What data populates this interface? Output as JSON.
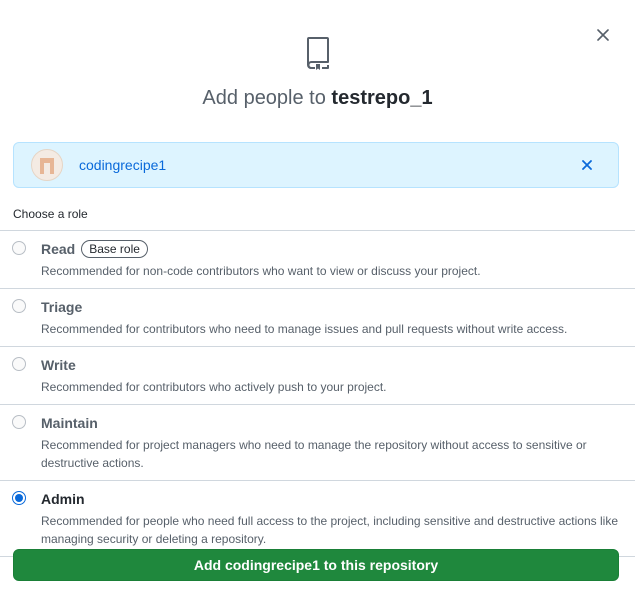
{
  "dialog": {
    "close_icon": "x-icon",
    "repo_icon": "repo-icon",
    "title_prefix": "Add people to",
    "repo_name": "testrepo_1"
  },
  "selected_user": {
    "username": "codingrecipe1",
    "remove_icon": "x-icon",
    "colors": {
      "background": "#ddf4ff",
      "link": "#0969da"
    }
  },
  "role_heading": "Choose a role",
  "roles": [
    {
      "name": "Read",
      "badge": "Base role",
      "description": "Recommended for non-code contributors who want to view or discuss your project.",
      "selected": false
    },
    {
      "name": "Triage",
      "badge": "",
      "description": "Recommended for contributors who need to manage issues and pull requests without write access.",
      "selected": false
    },
    {
      "name": "Write",
      "badge": "",
      "description": "Recommended for contributors who actively push to your project.",
      "selected": false
    },
    {
      "name": "Maintain",
      "badge": "",
      "description": "Recommended for project managers who need to manage the repository without access to sensitive or destructive actions.",
      "selected": false
    },
    {
      "name": "Admin",
      "badge": "",
      "description": "Recommended for people who need full access to the project, including sensitive and destructive actions like managing security or deleting a repository.",
      "selected": true
    }
  ],
  "submit_button": {
    "label": "Add codingrecipe1 to this repository",
    "color": "#1f883d"
  }
}
